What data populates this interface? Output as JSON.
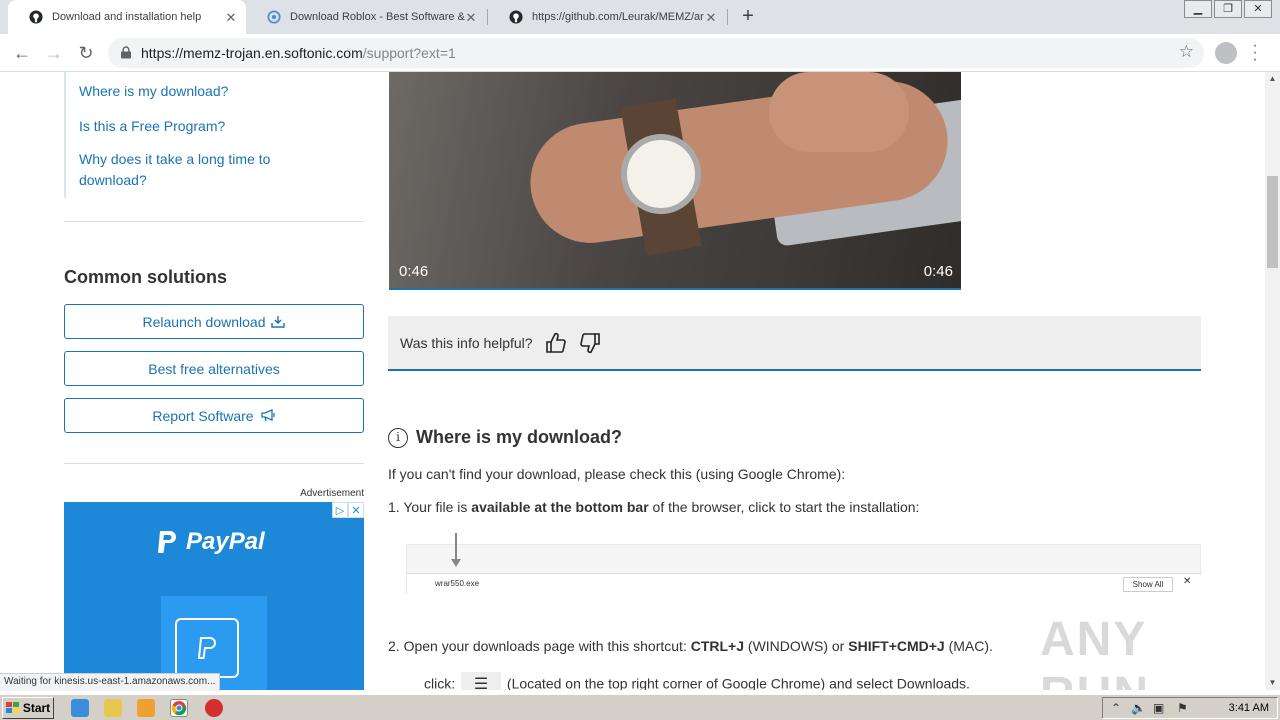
{
  "browser": {
    "tabs": [
      {
        "title": "Download and installation help",
        "icon": "github-like-favicon",
        "active": true
      },
      {
        "title": "Download Roblox - Best Software &",
        "icon": "softonic-favicon",
        "active": false
      },
      {
        "title": "https://github.com/Leurak/MEMZ/ar",
        "icon": "github-favicon",
        "active": false
      }
    ],
    "url_main": "https://memz-trojan.en.softonic.com",
    "url_path": "/support?ext=1"
  },
  "sidebar": {
    "links": [
      "Where is my download?",
      "Is this a Free Program?",
      "Why does it take a long time to",
      "download?"
    ],
    "common_title": "Common solutions",
    "buttons": {
      "relaunch": "Relaunch download",
      "alternatives": "Best free alternatives",
      "report": "Report Software"
    },
    "ad_label": "Advertisement",
    "ad_brand": "PayPal"
  },
  "video": {
    "time_left": "0:46",
    "time_right": "0:46"
  },
  "helpful": {
    "question": "Was this info helpful?"
  },
  "article": {
    "heading": "Where is my download?",
    "intro": "If you can't find your download, please check this (using Google Chrome):",
    "step1_prefix": "1. Your file is ",
    "step1_bold": "available at the bottom bar",
    "step1_suffix": " of the browser, click to start the installation:",
    "shot_filename": "wrar550.exe",
    "shot_showall": "Show All",
    "step2_prefix": "2. Open your downloads page with this shortcut: ",
    "step2_bold1": "CTRL+J",
    "step2_mid": " (WINDOWS) or ",
    "step2_bold2": "SHIFT+CMD+J",
    "step2_suffix": " (MAC).",
    "step3_prefix": "click:",
    "step3_suffix": "(Located on the top right corner of Google Chrome) and select Downloads."
  },
  "status_text": "Waiting for kinesis.us-east-1.amazonaws.com...",
  "watermark": "ANY RUN",
  "taskbar": {
    "start": "Start",
    "clock": "3:41 AM"
  }
}
